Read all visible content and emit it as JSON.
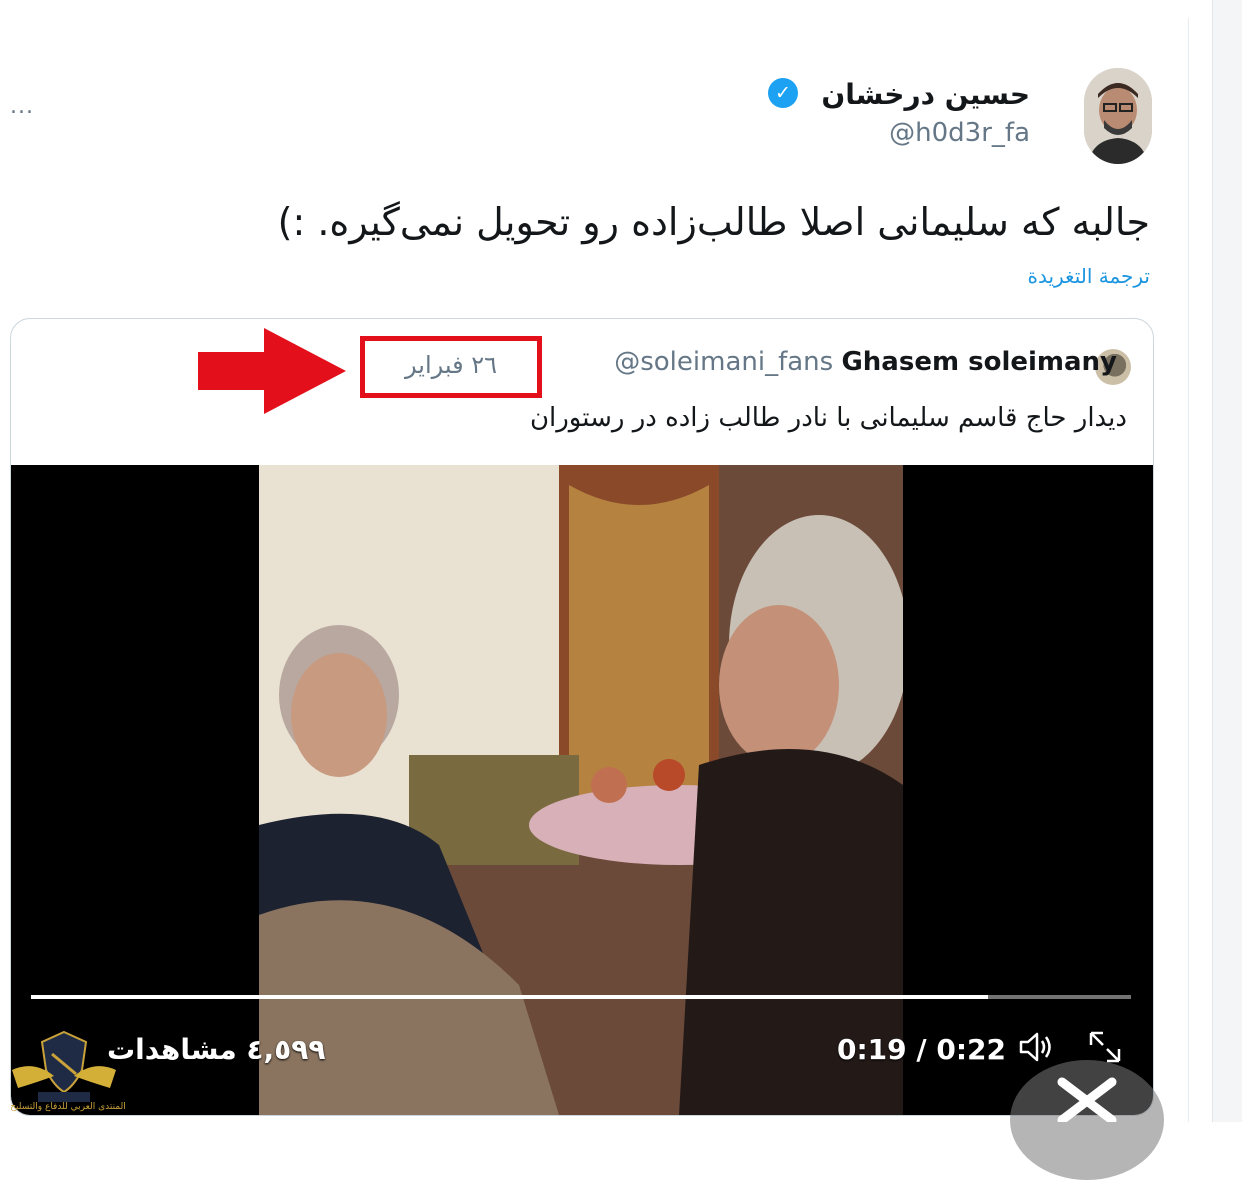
{
  "tweet": {
    "author_name": "حسين درخشان",
    "author_handle": "@h0d3r_fa",
    "text": "جالبه که سلیمانی اصلا طالب‌زاده رو تحویل نمی‌گیره. :)",
    "translate_label": "ترجمة التغريدة",
    "more_label": "...",
    "verified": true
  },
  "quoted": {
    "author_name": "Ghasem soleimany",
    "author_handle": "@soleimani_fans",
    "date": "٢٦ فبراير",
    "text": "دیدار حاج قاسم سلیمانی با نادر طالب زاده در رستوران"
  },
  "video": {
    "views": "٤,٥٩٩ مشاهدات",
    "time": "0:19 / 0:22",
    "progress_fraction": 0.87
  },
  "watermark": {
    "line": "المنتدى العربي للدفاع والتسليح"
  },
  "colors": {
    "accent": "#1da1f2",
    "link": "#1b95e0",
    "annotation_red": "#e3101c"
  },
  "icons": [
    "more-icon",
    "verified-icon",
    "volume-icon",
    "fullscreen-icon",
    "annotation-arrow",
    "close-icon"
  ]
}
